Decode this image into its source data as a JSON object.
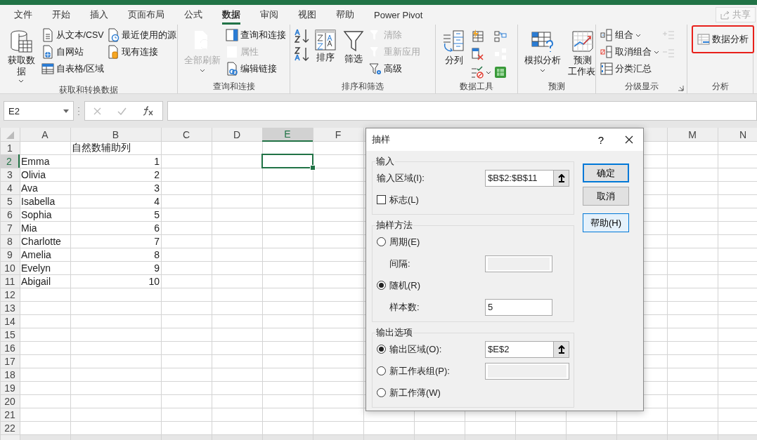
{
  "tabs": [
    {
      "label": "文件",
      "selected": false
    },
    {
      "label": "开始",
      "selected": false
    },
    {
      "label": "插入",
      "selected": false
    },
    {
      "label": "页面布局",
      "selected": false
    },
    {
      "label": "公式",
      "selected": false
    },
    {
      "label": "数据",
      "selected": true
    },
    {
      "label": "审阅",
      "selected": false
    },
    {
      "label": "视图",
      "selected": false
    },
    {
      "label": "帮助",
      "selected": false
    },
    {
      "label": "Power Pivot",
      "selected": false
    }
  ],
  "share_button": {
    "label": "共享",
    "disabled": true
  },
  "ribbon": {
    "groups": [
      {
        "label": "获取和转换数据",
        "launcher": false,
        "highlighted": false,
        "items": [
          {
            "kind": "large",
            "label": "获取数据",
            "disabled": false,
            "dropdown": true
          },
          {
            "kind": "small",
            "label": "从文本/CSV",
            "disabled": false,
            "dropdown": false
          },
          {
            "kind": "small",
            "label": "自网站",
            "disabled": false,
            "dropdown": false
          },
          {
            "kind": "small",
            "label": "自表格/区域",
            "disabled": false,
            "dropdown": false
          },
          {
            "kind": "small",
            "label": "最近使用的源",
            "disabled": false,
            "dropdown": false
          },
          {
            "kind": "small",
            "label": "现有连接",
            "disabled": false,
            "dropdown": false
          }
        ]
      },
      {
        "label": "查询和连接",
        "launcher": false,
        "highlighted": false,
        "items": [
          {
            "kind": "large",
            "label": "全部刷新",
            "disabled": true,
            "dropdown": true
          },
          {
            "kind": "small",
            "label": "查询和连接",
            "disabled": false,
            "dropdown": false
          },
          {
            "kind": "small",
            "label": "属性",
            "disabled": true,
            "dropdown": false
          },
          {
            "kind": "small",
            "label": "编辑链接",
            "disabled": false,
            "dropdown": false
          }
        ]
      },
      {
        "label": "排序和筛选",
        "launcher": false,
        "highlighted": false,
        "items": [
          {
            "kind": "icon",
            "disabled": false,
            "dropdown": false
          },
          {
            "kind": "icon",
            "disabled": false,
            "dropdown": false
          },
          {
            "kind": "large",
            "label": "排序",
            "disabled": false,
            "dropdown": false
          },
          {
            "kind": "large",
            "label": "筛选",
            "disabled": false,
            "dropdown": false
          },
          {
            "kind": "small",
            "label": "清除",
            "disabled": true,
            "dropdown": false
          },
          {
            "kind": "small",
            "label": "重新应用",
            "disabled": true,
            "dropdown": false
          },
          {
            "kind": "small",
            "label": "高级",
            "disabled": false,
            "dropdown": false
          }
        ]
      },
      {
        "label": "数据工具",
        "launcher": false,
        "highlighted": false,
        "items": [
          {
            "kind": "large",
            "label": "分列",
            "disabled": false,
            "dropdown": false
          },
          {
            "kind": "icon",
            "disabled": false,
            "dropdown": false
          },
          {
            "kind": "icon",
            "disabled": false,
            "dropdown": false
          },
          {
            "kind": "icon",
            "disabled": false,
            "dropdown": true
          },
          {
            "kind": "icon",
            "disabled": false,
            "dropdown": false
          },
          {
            "kind": "icon",
            "disabled": true,
            "dropdown": false
          },
          {
            "kind": "icon",
            "disabled": false,
            "dropdown": false
          }
        ]
      },
      {
        "label": "预测",
        "launcher": false,
        "highlighted": false,
        "items": [
          {
            "kind": "large",
            "label": "模拟分析",
            "disabled": false,
            "dropdown": true
          },
          {
            "kind": "large",
            "label": "预测工作表",
            "disabled": false,
            "dropdown": false
          }
        ]
      },
      {
        "label": "分级显示",
        "launcher": true,
        "highlighted": false,
        "items": [
          {
            "kind": "small",
            "label": "组合",
            "disabled": false,
            "dropdown": true
          },
          {
            "kind": "small",
            "label": "取消组合",
            "disabled": false,
            "dropdown": true
          },
          {
            "kind": "small",
            "label": "分类汇总",
            "disabled": false,
            "dropdown": false
          },
          {
            "kind": "icon",
            "disabled": true,
            "dropdown": false
          },
          {
            "kind": "icon",
            "disabled": true,
            "dropdown": false
          }
        ]
      },
      {
        "label": "分析",
        "launcher": false,
        "highlighted": true,
        "items": [
          {
            "kind": "small",
            "label": "数据分析",
            "disabled": false,
            "dropdown": false
          }
        ]
      }
    ]
  },
  "formula_bar": {
    "name_box": "E2"
  },
  "grid": {
    "columns": [
      {
        "label": "A",
        "selected": false
      },
      {
        "label": "B",
        "selected": false
      },
      {
        "label": "C",
        "selected": false
      },
      {
        "label": "D",
        "selected": false
      },
      {
        "label": "E",
        "selected": true
      },
      {
        "label": "F",
        "selected": false
      }
    ],
    "columns_right": [
      {
        "label": "M"
      },
      {
        "label": "N"
      }
    ],
    "rows": [
      {
        "number": "1",
        "selected": false,
        "b": "自然数辅助列"
      },
      {
        "number": "2",
        "selected": true,
        "a": "Emma",
        "b": "1"
      },
      {
        "number": "3",
        "selected": false,
        "a": "Olivia",
        "b": "2"
      },
      {
        "number": "4",
        "selected": false,
        "a": "Ava",
        "b": "3"
      },
      {
        "number": "5",
        "selected": false,
        "a": "Isabella",
        "b": "4"
      },
      {
        "number": "6",
        "selected": false,
        "a": "Sophia",
        "b": "5"
      },
      {
        "number": "7",
        "selected": false,
        "a": "Mia",
        "b": "6"
      },
      {
        "number": "8",
        "selected": false,
        "a": "Charlotte",
        "b": "7"
      },
      {
        "number": "9",
        "selected": false,
        "a": "Amelia",
        "b": "8"
      },
      {
        "number": "10",
        "selected": false,
        "a": "Evelyn",
        "b": "9"
      },
      {
        "number": "11",
        "selected": false,
        "a": "Abigail",
        "b": "10"
      },
      {
        "number": "12",
        "selected": false
      },
      {
        "number": "13",
        "selected": false
      },
      {
        "number": "14",
        "selected": false
      },
      {
        "number": "15",
        "selected": false
      },
      {
        "number": "16",
        "selected": false
      },
      {
        "number": "17",
        "selected": false
      },
      {
        "number": "18",
        "selected": false
      },
      {
        "number": "19",
        "selected": false
      },
      {
        "number": "20",
        "selected": false
      },
      {
        "number": "21",
        "selected": false
      },
      {
        "number": "22",
        "selected": false
      }
    ]
  },
  "dialog": {
    "title": "抽样",
    "help": "?",
    "sections": [
      {
        "title": "输入",
        "rows": [
          {
            "kind": "field",
            "label": "输入区域(I):",
            "value": "$B$2:$B$11",
            "picker": true,
            "disabled": false
          },
          {
            "kind": "checkbox",
            "label": "标志(L)",
            "checked": false
          }
        ]
      },
      {
        "title": "抽样方法",
        "rows": [
          {
            "kind": "radio",
            "label": "周期(E)",
            "selected": false
          },
          {
            "kind": "subfield",
            "label": "间隔:",
            "picker": false,
            "disabled": true
          },
          {
            "kind": "radio",
            "label": "随机(R)",
            "selected": true
          },
          {
            "kind": "subfield",
            "label": "样本数:",
            "value": "5",
            "picker": false,
            "disabled": false
          }
        ]
      },
      {
        "title": "输出选项",
        "rows": [
          {
            "kind": "radio",
            "label": "输出区域(O):",
            "selected": true,
            "field": {
              "value": "$E$2",
              "picker": true,
              "disabled": false
            }
          },
          {
            "kind": "radio",
            "label": "新工作表组(P):",
            "selected": false,
            "field": {
              "picker": false,
              "disabled": true
            }
          },
          {
            "kind": "radio",
            "label": "新工作薄(W)",
            "selected": false
          }
        ]
      }
    ],
    "buttons": [
      {
        "label": "确定",
        "kind": "default"
      },
      {
        "label": "取消",
        "kind": "normal"
      },
      {
        "label": "帮助(H)",
        "kind": "hover"
      }
    ]
  }
}
